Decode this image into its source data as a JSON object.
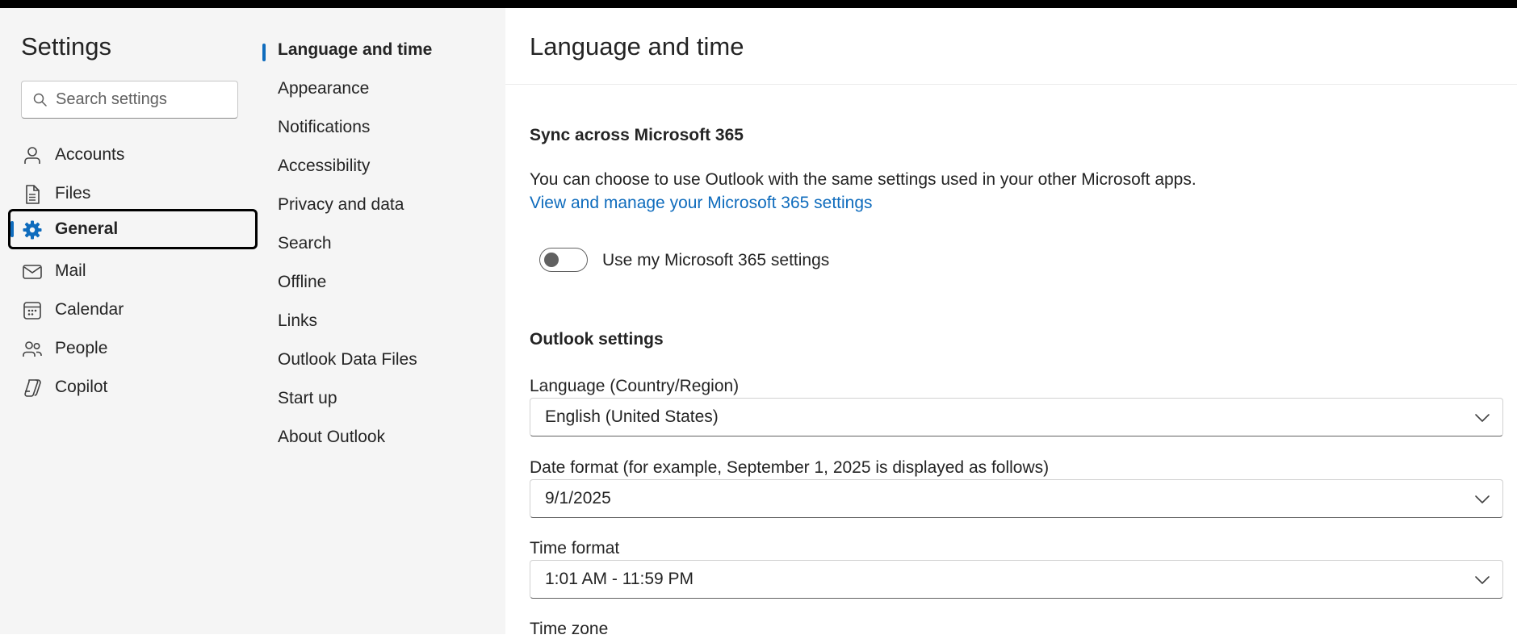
{
  "left_nav": {
    "title": "Settings",
    "search": {
      "placeholder": "Search settings",
      "value": ""
    },
    "items": [
      {
        "label": "Accounts",
        "icon": "person-icon"
      },
      {
        "label": "Files",
        "icon": "document-icon"
      },
      {
        "label": "General",
        "icon": "gear-icon",
        "selected": true
      },
      {
        "label": "Mail",
        "icon": "mail-icon"
      },
      {
        "label": "Calendar",
        "icon": "calendar-icon"
      },
      {
        "label": "People",
        "icon": "people-icon"
      },
      {
        "label": "Copilot",
        "icon": "copilot-icon"
      }
    ]
  },
  "sub_nav": {
    "items": [
      {
        "label": "Language and time",
        "active": true
      },
      {
        "label": "Appearance"
      },
      {
        "label": "Notifications"
      },
      {
        "label": "Accessibility"
      },
      {
        "label": "Privacy and data"
      },
      {
        "label": "Search"
      },
      {
        "label": "Offline"
      },
      {
        "label": "Links"
      },
      {
        "label": "Outlook Data Files"
      },
      {
        "label": "Start up"
      },
      {
        "label": "About Outlook"
      }
    ]
  },
  "main": {
    "title": "Language and time",
    "sync": {
      "heading": "Sync across Microsoft 365",
      "description": "You can choose to use Outlook with the same settings used in your other Microsoft apps.",
      "link": "View and manage your Microsoft 365 settings",
      "toggle_label": "Use my Microsoft 365 settings",
      "toggle_on": false
    },
    "outlook_settings": {
      "heading": "Outlook settings",
      "language": {
        "label": "Language (Country/Region)",
        "value": "English (United States)"
      },
      "date_format": {
        "label": "Date format (for example, September 1, 2025 is displayed as follows)",
        "value": "9/1/2025"
      },
      "time_format": {
        "label": "Time format",
        "value": "1:01 AM - 11:59 PM"
      },
      "time_zone": {
        "label": "Time zone"
      }
    }
  },
  "colors": {
    "accent": "#0f6cbd",
    "nav_background": "#f5f5f5",
    "top_bar": "#000000"
  }
}
